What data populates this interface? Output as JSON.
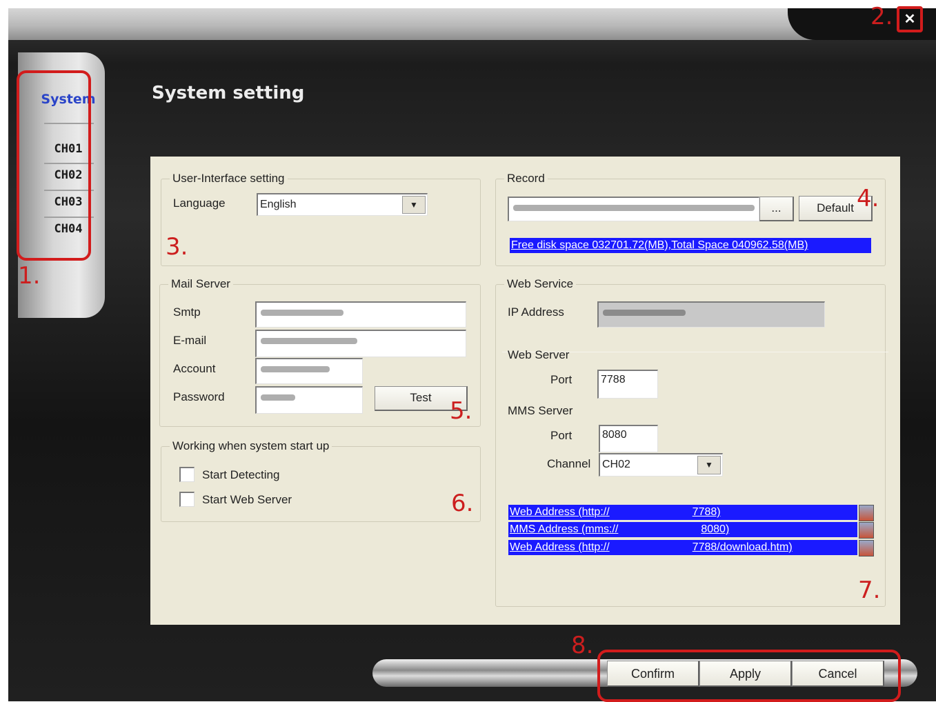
{
  "window": {
    "heading": "System setting",
    "close_glyph": "✕"
  },
  "sidebar": {
    "items": [
      {
        "label": "System",
        "active": true
      },
      {
        "label": "CH01"
      },
      {
        "label": "CH02"
      },
      {
        "label": "CH03"
      },
      {
        "label": "CH04"
      }
    ]
  },
  "ui_setting": {
    "legend": "User-Interface setting",
    "language_label": "Language",
    "language_value": "English"
  },
  "record": {
    "legend": "Record",
    "browse_label": "...",
    "default_label": "Default",
    "disk_info": "Free disk space 032701.72(MB),Total Space 040962.58(MB)"
  },
  "mail": {
    "legend": "Mail Server",
    "smtp_label": "Smtp",
    "email_label": "E-mail",
    "account_label": "Account",
    "password_label": "Password",
    "test_label": "Test"
  },
  "startup": {
    "legend": "Working when system start up",
    "start_detecting": "Start Detecting",
    "start_web_server": "Start Web Server"
  },
  "web": {
    "legend": "Web Service",
    "ip_label": "IP Address",
    "web_server_label": "Web Server",
    "port_label": "Port",
    "web_port": "7788",
    "mms_server_label": "MMS Server",
    "mms_port_label": "Port",
    "mms_port": "8080",
    "channel_label": "Channel",
    "channel_value": "CH02",
    "addresses": [
      {
        "prefix": "Web Address (http://",
        "suffix": "7788)"
      },
      {
        "prefix": "MMS Address (mms://",
        "suffix": "8080)"
      },
      {
        "prefix": "Web Address (http://",
        "suffix": "7788/download.htm)"
      }
    ]
  },
  "footer": {
    "confirm": "Confirm",
    "apply": "Apply",
    "cancel": "Cancel"
  },
  "annotations": [
    "1.",
    "2.",
    "3.",
    "4.",
    "5.",
    "6.",
    "7.",
    "8."
  ],
  "colors": {
    "annotation_red": "#d21c1c",
    "highlight_blue": "#1a1aff",
    "panel_bg": "#ece9d8"
  }
}
